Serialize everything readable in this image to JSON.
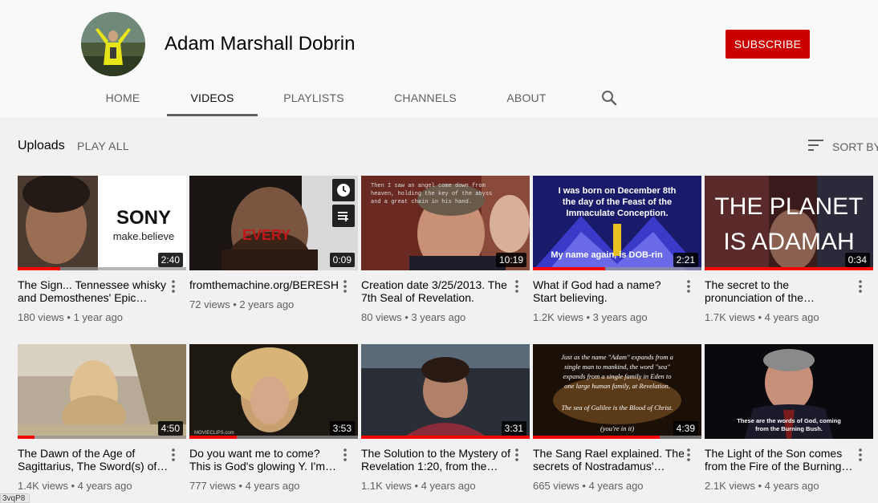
{
  "channel": {
    "name": "Adam Marshall Dobrin",
    "subscribe_label": "SUBSCRIBE"
  },
  "tabs": [
    {
      "label": "HOME"
    },
    {
      "label": "VIDEOS"
    },
    {
      "label": "PLAYLISTS"
    },
    {
      "label": "CHANNELS"
    },
    {
      "label": "ABOUT"
    }
  ],
  "active_tab": "VIDEOS",
  "section": {
    "title": "Uploads",
    "play_all_label": "PLAY ALL",
    "sort_label": "SORT BY"
  },
  "icons": {
    "search": "search-icon",
    "sort": "sort-icon",
    "menu": "more-vert-icon",
    "watch_later": "clock-icon",
    "add_to_queue": "queue-icon"
  },
  "colors": {
    "subscribe": "#cc0000",
    "progress": "#ff0000",
    "page_bg": "#f1f1f1",
    "header_bg": "#f9f9f9"
  },
  "videos": [
    {
      "title": "The Sign... Tennessee whisky and Demosthenes' Epic…",
      "views": "180 views",
      "age": "1 year ago",
      "duration": "2:40",
      "progress": 0.25,
      "thumb_text": [
        "SONY",
        "make.believe"
      ]
    },
    {
      "title": "fromthemachine.org/BERESH",
      "views": "72 views",
      "age": "2 years ago",
      "duration": "0:09",
      "progress": 0,
      "thumb_text": [
        "EVERY"
      ]
    },
    {
      "title": "Creation date 3/25/2013. The 7th Seal of Revelation.",
      "views": "80 views",
      "age": "3 years ago",
      "duration": "10:19",
      "progress": 0,
      "thumb_text": [
        "Then I saw an angel come down from",
        "heaven, holding the key of the abyss",
        "and a great chain in his hand."
      ]
    },
    {
      "title": "What if God had a name? Start believing.",
      "views": "1.2K views",
      "age": "3 years ago",
      "duration": "2:21",
      "progress": 0.43,
      "thumb_text": [
        "I was born on December 8th",
        "the day of the Feast of the",
        "Immaculate Conception.",
        "My name again, is DOB-rin"
      ]
    },
    {
      "title": "The secret to the pronunciation of the…",
      "views": "1.7K views",
      "age": "4 years ago",
      "duration": "0:34",
      "progress": 1,
      "thumb_text": [
        "THE PLANET",
        "IS ADAMAH"
      ]
    },
    {
      "title": "The Dawn of the Age of Sagittarius, The Sword(s) of…",
      "views": "1.4K views",
      "age": "4 years ago",
      "duration": "4:50",
      "progress": 0.1,
      "thumb_text": []
    },
    {
      "title": "Do you want me to come? This is God's glowing Y. I'm…",
      "views": "777 views",
      "age": "4 years ago",
      "duration": "3:53",
      "progress": 0.28,
      "thumb_text": [
        "MOVIECLIPS.com"
      ]
    },
    {
      "title": "The Solution to the Mystery of Revelation 1:20, from the…",
      "views": "1.1K views",
      "age": "4 years ago",
      "duration": "3:31",
      "progress": 1,
      "thumb_text": []
    },
    {
      "title": "The Sang Rael explained. The secrets of Nostradamus'…",
      "views": "665 views",
      "age": "4 years ago",
      "duration": "4:39",
      "progress": 0.75,
      "thumb_text": [
        "Just as the name \"Adam\" expands from a",
        "single man to mankind, the word \"sea\"",
        "expands from a single family in Eden to",
        "one large human family, at Revelation.",
        "The sea of Galilee is the Blood of Christ.",
        "(you're in it)"
      ]
    },
    {
      "title": "The Light of the Son comes from the Fire of the Burning…",
      "views": "2.1K views",
      "age": "4 years ago",
      "duration": "",
      "progress": 0,
      "thumb_text": [
        "These are the words of God, coming",
        "from the Burning Bush."
      ]
    }
  ],
  "status_text": "3vqP8"
}
